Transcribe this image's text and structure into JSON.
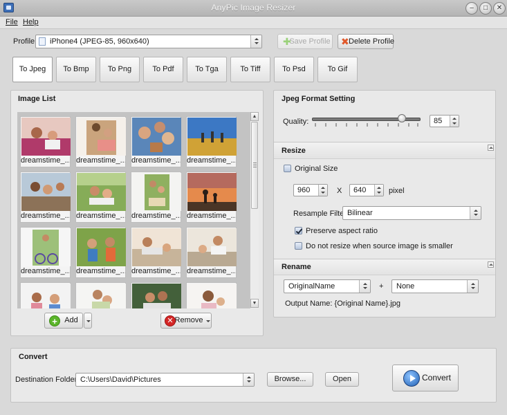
{
  "window": {
    "title": "AnyPic Image Resizer"
  },
  "menu": {
    "file": "File",
    "help": "Help"
  },
  "profile": {
    "label": "Profile",
    "value": "iPhone4 (JPEG-85, 960x640)",
    "save_label": "Save Profile",
    "delete_label": "Delete Profile"
  },
  "tabs": [
    {
      "label": "To Jpeg"
    },
    {
      "label": "To Bmp"
    },
    {
      "label": "To Png"
    },
    {
      "label": "To Pdf"
    },
    {
      "label": "To Tga"
    },
    {
      "label": "To Tiff"
    },
    {
      "label": "To Psd"
    },
    {
      "label": "To Gif"
    }
  ],
  "image_list": {
    "title": "Image List",
    "items": [
      {
        "caption": "dreamstime_..."
      },
      {
        "caption": "dreamstime_..."
      },
      {
        "caption": "dreamstime_..."
      },
      {
        "caption": "dreamstime_..."
      },
      {
        "caption": "dreamstime_..."
      },
      {
        "caption": "dreamstime_..."
      },
      {
        "caption": "dreamstime_..."
      },
      {
        "caption": "dreamstime_..."
      },
      {
        "caption": "dreamstime_..."
      },
      {
        "caption": "dreamstime_..."
      },
      {
        "caption": "dreamstime_..."
      },
      {
        "caption": "dreamstime_..."
      },
      {
        "caption": ""
      },
      {
        "caption": ""
      },
      {
        "caption": ""
      },
      {
        "caption": ""
      }
    ],
    "add_label": "Add",
    "remove_label": "Remove"
  },
  "jpeg_settings": {
    "title": "Jpeg Format Setting",
    "quality_label": "Quality:",
    "quality_value": "85"
  },
  "resize": {
    "title": "Resize",
    "original_size_label": "Original Size",
    "width": "960",
    "x_label": "X",
    "height": "640",
    "unit": "pixel",
    "filter_label": "Resample Filter:",
    "filter_value": "Bilinear",
    "preserve_label": "Preserve aspect ratio",
    "no_resize_label": "Do not resize when source image is smaller"
  },
  "rename": {
    "title": "Rename",
    "part1": "OriginalName",
    "plus": "+",
    "part2": "None",
    "output_label": "Output Name:",
    "output_value": "{Original Name}.jpg"
  },
  "convert": {
    "title": "Convert",
    "dest_label": "Destination Folder:",
    "dest_value": "C:\\Users\\David\\Pictures",
    "browse_label": "Browse...",
    "open_label": "Open",
    "convert_label": "Convert"
  },
  "colors": {
    "add_icon": "#5bb52a",
    "remove_icon": "#d42626",
    "convert_icon": "#2f7fd6"
  }
}
